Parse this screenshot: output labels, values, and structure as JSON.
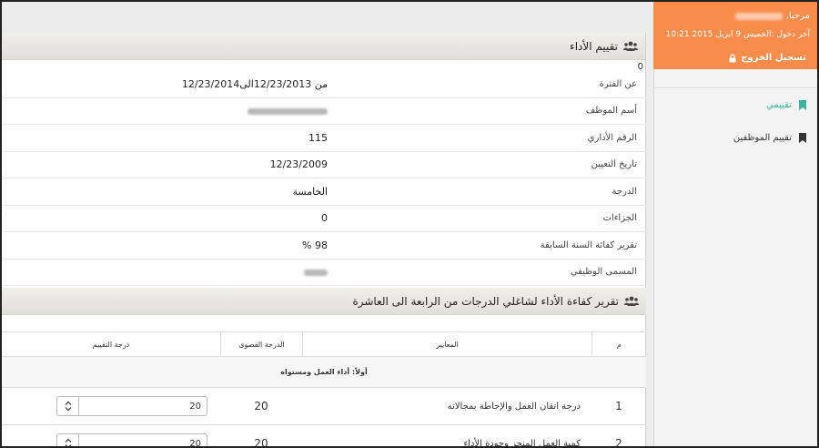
{
  "sidebar": {
    "greeting": "مرحبا,",
    "last_login": "آخر دخول :الخميس 9 ابريل 2015 10:21",
    "logout_label": "تسجيل الخروج",
    "menu": [
      {
        "label": "تقييمي",
        "icon": "bookmark-icon",
        "active": true
      },
      {
        "label": "تقييم الموظفين",
        "icon": "bookmark-icon",
        "active": false
      }
    ],
    "accent_color": "#f88c4b",
    "active_color": "#3ab39a"
  },
  "panel1": {
    "title": "تقييم الأداء",
    "zero_marker": "0",
    "rows": [
      {
        "label": "عن الفترة",
        "value": "من 12/23/2013الى12/23/2014"
      },
      {
        "label": "أسم الموظف",
        "value": ""
      },
      {
        "label": "الرقم الأداري",
        "value": "115"
      },
      {
        "label": "تاريخ التعيين",
        "value": "12/23/2009"
      },
      {
        "label": "الدرجة",
        "value": "الخامسة"
      },
      {
        "label": "الجزاءات",
        "value": "0"
      },
      {
        "label": "تقرير كفائة السنة السابقة",
        "value": "98 %"
      },
      {
        "label": "المسمى الوظيفي",
        "value": ""
      }
    ]
  },
  "panel2": {
    "title": "تقرير كفاءة الأداء لشاغلي الدرجات من الرابعة الى العاشرة",
    "headers": {
      "num": "م",
      "criteria": "المعايير",
      "max": "الدرجة القصوى",
      "score": "درجة التقييم"
    },
    "group_label": "أولاً: أداء العمل ومستواه",
    "rows": [
      {
        "num": "1",
        "criteria": "درجة اتقان العمل والإحاطة بمجالاته",
        "max": "20",
        "score": "20"
      },
      {
        "num": "2",
        "criteria": "كمية العمل المنجز وجودة الأداء",
        "max": "20",
        "score": "20"
      }
    ]
  }
}
